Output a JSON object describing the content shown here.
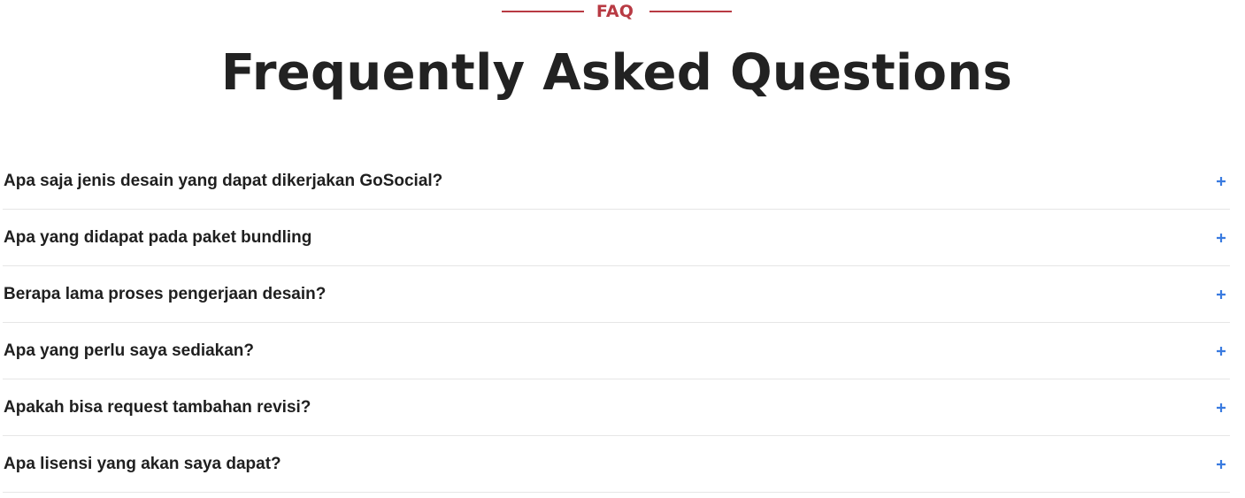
{
  "header": {
    "eyebrow": "FAQ",
    "title": "Frequently Asked Questions"
  },
  "faq": {
    "items": [
      {
        "question": "Apa saja jenis desain yang dapat dikerjakan GoSocial?",
        "icon": "plus-icon"
      },
      {
        "question": "Apa yang didapat pada paket bundling",
        "icon": "plus-icon"
      },
      {
        "question": "Berapa lama proses pengerjaan desain?",
        "icon": "plus-icon"
      },
      {
        "question": "Apa yang perlu saya sediakan?",
        "icon": "plus-icon"
      },
      {
        "question": "Apakah bisa request tambahan revisi?",
        "icon": "plus-icon"
      },
      {
        "question": "Apa lisensi yang akan saya dapat?",
        "icon": "plus-icon"
      }
    ]
  },
  "colors": {
    "accent": "#b83a43",
    "icon": "#3a7be0",
    "text": "#222222",
    "divider": "#e6e6e6"
  }
}
